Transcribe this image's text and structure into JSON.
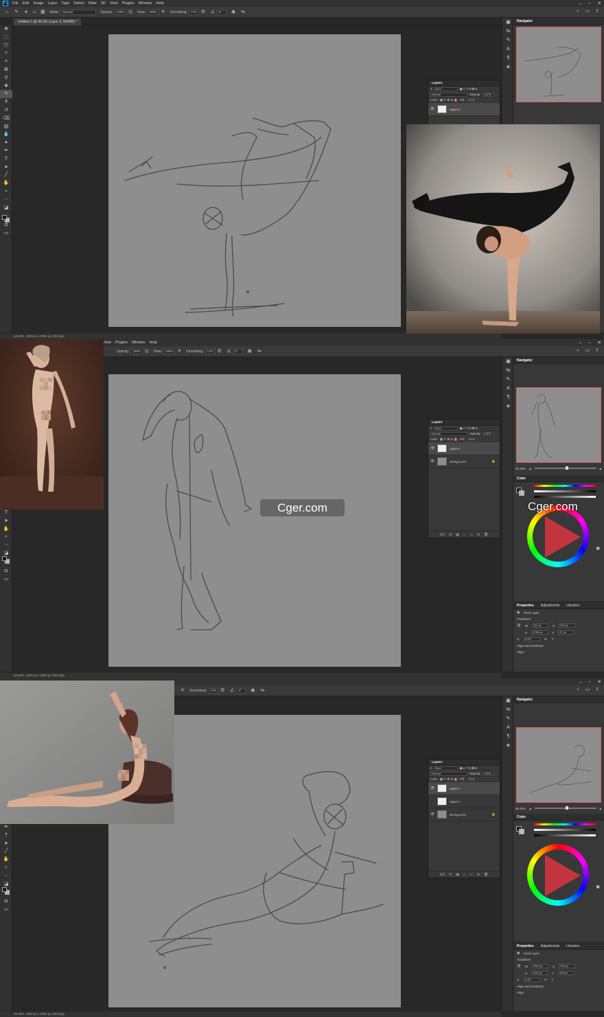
{
  "app": {
    "menu": [
      "File",
      "Edit",
      "Image",
      "Layer",
      "Type",
      "Select",
      "Filter",
      "3D",
      "View",
      "Plugins",
      "Window",
      "Help"
    ],
    "menu_partial": [
      "View",
      "Plugins",
      "Window",
      "Help"
    ],
    "logo": "Ps"
  },
  "options": {
    "brush_size": "10",
    "mode_label": "Mode:",
    "mode_value": "Normal",
    "opacity_label": "Opacity:",
    "opacity_value": "100%",
    "flow_label": "Flow:",
    "flow_value": "100%",
    "smoothing_label": "Smoothing:",
    "smoothing_value": "17%",
    "angle_value": "0°"
  },
  "document": {
    "tab_title": "Untitled-1 @ 46.5% (Layer 3, RGB/8) *",
    "status_zoom": "46.49%",
    "status_size": "2000 px x 2000 px (300 ppi)"
  },
  "panels": {
    "navigator_title": "Navigator",
    "navigator_zoom": "46.49%",
    "color_title": "Color",
    "properties_tab": "Properties",
    "adjustments_tab": "Adjustments",
    "libraries_tab": "Libraries",
    "pixel_layer": "Pixel Layer",
    "transform_label": "Transform",
    "align_label": "Align and Distribute",
    "align_sub": "Align:",
    "panel2": {
      "w": "781 px",
      "h": "1755 px",
      "x": "220 px",
      "y": "67 px",
      "angle": "0.00°"
    },
    "panel3": {
      "w": "1664 px",
      "h": "1182 px",
      "x": "232 px",
      "y": "466 px",
      "angle": "0.00°"
    }
  },
  "layers": {
    "title": "Layers",
    "kind": "Kind",
    "blend": "Normal",
    "opacity_label": "Opacity:",
    "opacity_value": "100%",
    "lock_label": "Lock:",
    "fill_label": "Fill:",
    "fill_value": "100%",
    "layer3": "Layer 3",
    "layer2": "Layer 2",
    "layer1": "Layer 1",
    "background": "Background",
    "footer_icons": [
      "GO",
      "fx",
      "▣",
      "◐",
      "▭",
      "⊕",
      "🗑"
    ]
  },
  "watermark": "Cger.com"
}
